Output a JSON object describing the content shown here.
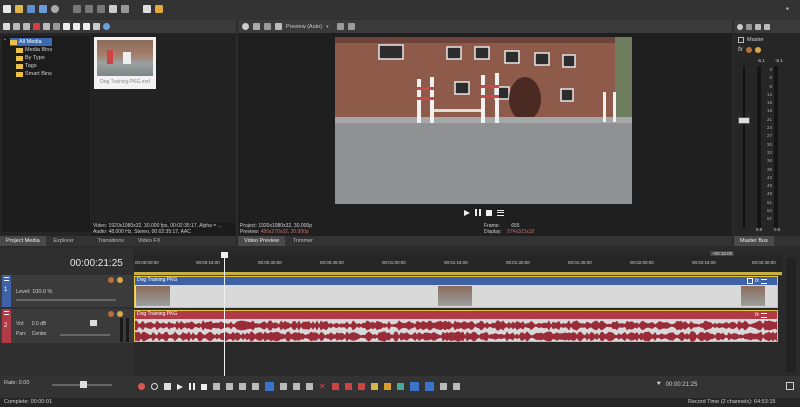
{
  "toolbar_icons": [
    "new-icon",
    "open-icon",
    "save-icon",
    "save-as-icon",
    "properties-icon",
    "settings-icon",
    "cut-icon",
    "copy-icon",
    "paste-icon",
    "delete-icon",
    "undo-icon",
    "redo-icon",
    "selection-icon",
    "envelope-icon"
  ],
  "media_panel": {
    "tree": [
      "All Media",
      "Media Bins",
      "By Type",
      "Tags",
      "Smart Bins"
    ],
    "thumb_label": "Dog Training PKG.mxf",
    "info_video": "Video: 1920x1080x32, 30.000 fps, 00:02:35:17, Alpha = ...",
    "info_audio": "Audio: 48,000 Hz, Stereo, 00:02:35:17, AAC"
  },
  "tabs_left": [
    "Project Media",
    "Explorer",
    "Transitions",
    "Video FX"
  ],
  "preview": {
    "mode": "Preview (Auto)",
    "project_label": "Project:",
    "project_value": "1920x1080x32, 30.000p",
    "preview_label": "Preview:",
    "preview_value": "480x270x32, 30.000p",
    "frame_label": "Frame:",
    "frame_value": "655",
    "display_label": "Display:",
    "display_value": "574x323x32"
  },
  "tabs_center": [
    "Video Preview",
    "Trimmer"
  ],
  "master": {
    "title": "Master",
    "level_l": "-6.1",
    "level_r": "-6.1",
    "scale": [
      "3",
      "6",
      "9",
      "12",
      "15",
      "18",
      "21",
      "24",
      "27",
      "30",
      "33",
      "36",
      "39",
      "42",
      "45",
      "48",
      "51",
      "54",
      "57"
    ],
    "bottom_l": "0.0",
    "bottom_r": "0.0",
    "tab": "Master Bus"
  },
  "timeline": {
    "timecode": "00:00:21:25",
    "ruler": [
      "00:00:00:00",
      "00:00:15:00",
      "00:00:30:00",
      "00:00:45:00",
      "00:01:00:00",
      "00:01:15:00",
      "00:01:30:00",
      "00:01:45:00",
      "00:02:00:00",
      "00:02:15:00",
      "00:02:30:00"
    ],
    "marker_pos": "+00:15:00",
    "video_track": {
      "num": "1",
      "level_label": "Level:",
      "level_value": "100.0 %",
      "clip": "Dog Training PKG"
    },
    "audio_track": {
      "num": "2",
      "vol_label": "Vol:",
      "vol_value": "0.0 dB",
      "pan_label": "Pan:",
      "pan_value": "Center",
      "clip": "Dog Training PKG"
    }
  },
  "transport": {
    "rate_label": "Rate: 0.00",
    "cursor_time": "00:00:21:25"
  },
  "status": {
    "left": "Complete: 00:00:01",
    "right": "Record Time (2 channels): 64:53:15"
  },
  "colors": {
    "video_clip": "#3f62a6",
    "audio_clip": "#b03a45",
    "clip_body": "#d8d8d8",
    "accent": "#ffd84a"
  }
}
